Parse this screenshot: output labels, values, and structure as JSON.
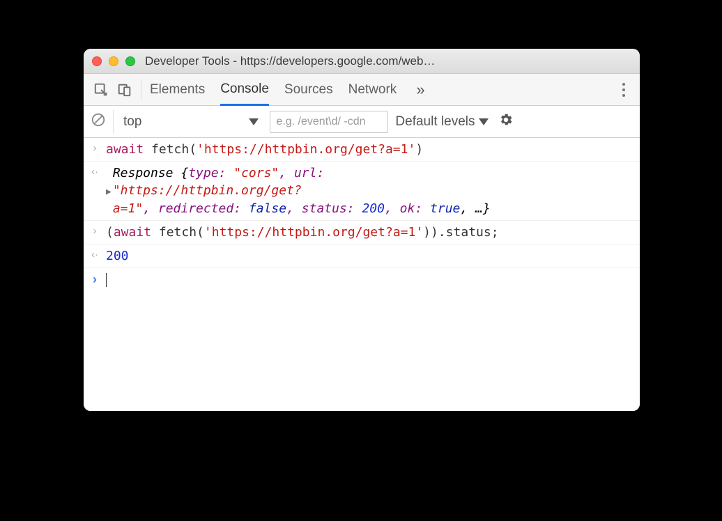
{
  "window": {
    "title": "Developer Tools - https://developers.google.com/web…"
  },
  "tabs": {
    "elements": "Elements",
    "console": "Console",
    "sources": "Sources",
    "network": "Network",
    "more": "»"
  },
  "toolbar": {
    "context": "top",
    "filter_placeholder": "e.g. /event\\d/ -cdn",
    "levels": "Default levels"
  },
  "console": {
    "line1": {
      "await": "await",
      "fetch": " fetch(",
      "url": "'https://httpbin.org/get?a=1'",
      "close": ")"
    },
    "line2": {
      "response": "Response ",
      "brace_open": "{",
      "type_k": "type: ",
      "type_v": "\"cors\"",
      "url_k": ", url: ",
      "url_v1": "\"https://httpbin.org/get?",
      "url_v2": "a=1\"",
      "redir_k": ", redirected: ",
      "redir_v": "false",
      "status_k": ", status: ",
      "status_v": "200",
      "ok_k": ", ok: ",
      "ok_v": "true",
      "rest": ", …}"
    },
    "line3": {
      "open": "(",
      "await": "await",
      "fetch": " fetch(",
      "url": "'https://httpbin.org/get?a=1'",
      "close": ")).status;"
    },
    "line4": {
      "value": "200"
    }
  }
}
